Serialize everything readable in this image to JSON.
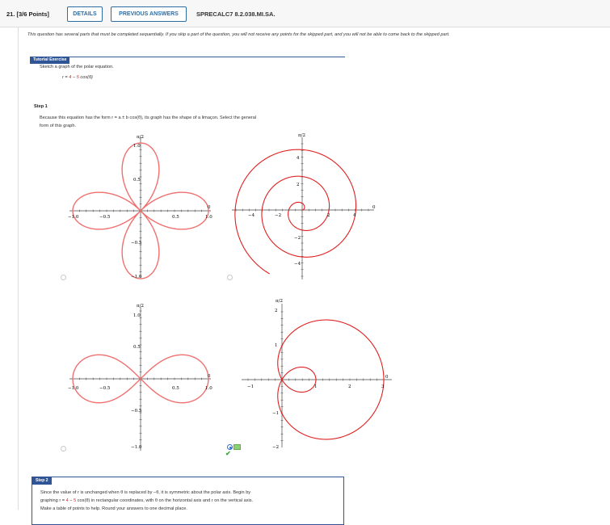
{
  "header": {
    "question_number": "21. [3/6 Points]",
    "details_label": "DETAILS",
    "previous_answers_label": "PREVIOUS ANSWERS",
    "problem_code": "SPRECALC7 8.2.038.MI.SA."
  },
  "notice": "This question has several parts that must be completed sequentially. If you skip a part of the question, you will not receive any points for the skipped part, and you will not be able to come back to the skipped part.",
  "tutorial": {
    "title": "Tutorial Exercise",
    "prompt": "Sketch a graph of the polar equation.",
    "equation_lhs": "r = ",
    "equation_a": "4",
    "equation_minus": " − ",
    "equation_b": "5",
    "equation_rhs": " cos(θ)"
  },
  "step1": {
    "label": "Step 1",
    "text_line1_a": "Because this equation has the form  r = a ± b cos(θ),  its graph has the shape of a limaçon. Select the general",
    "text_line2": "form of this graph."
  },
  "graphs": [
    {
      "id": "four-leaf-rose",
      "top_label": "π/2",
      "x_ticks": [
        "−1.0",
        "−0.5",
        "0.5",
        "1.0"
      ],
      "y_ticks": [
        "1.0",
        "0.5",
        "−0.5",
        "−1.0"
      ],
      "zero_label": "0",
      "selected": false
    },
    {
      "id": "spiral",
      "top_label": "π/2",
      "x_ticks": [
        "−4",
        "−2",
        "2",
        "4"
      ],
      "y_ticks": [
        "4",
        "2",
        "−2",
        "−4"
      ],
      "zero_label": "0",
      "selected": false
    },
    {
      "id": "lemniscate",
      "top_label": "π/2",
      "x_ticks": [
        "−1.0",
        "−0.5",
        "0.5",
        "1.0"
      ],
      "y_ticks": [
        "1.0",
        "0.5",
        "−0.5",
        "−1.0"
      ],
      "zero_label": "0",
      "selected": false
    },
    {
      "id": "limacon-inner-loop",
      "top_label": "π/2",
      "x_ticks": [
        "−1",
        "1",
        "2",
        "3"
      ],
      "y_ticks": [
        "2",
        "1",
        "−1",
        "−2"
      ],
      "zero_label": "0",
      "selected": true
    }
  ],
  "step2": {
    "label": "Step 2",
    "line1": "Since the value of r is unchanged when θ is replaced by −θ, it is symmetric about the polar axis. Begin by",
    "line2_a": "graphing  r = ",
    "line2_b": "4",
    "line2_c": " − ",
    "line2_d": "5",
    "line2_e": " cos(θ)  in rectangular coordinates, with θ on the horizontal axis and r on the vertical axis.",
    "line3": "Make a table of points to help. Round your answers to one decimal place."
  },
  "colors": {
    "accent": "#2f5597",
    "curve": "#e02020",
    "rose_curve": "#f07070",
    "correct": "#3da63d"
  }
}
